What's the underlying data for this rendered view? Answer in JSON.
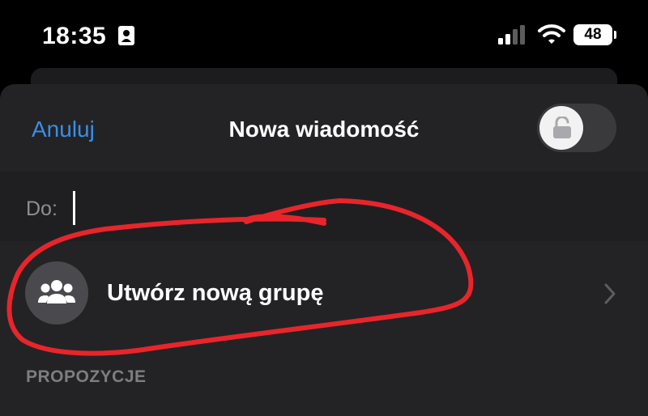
{
  "status_bar": {
    "time": "18:35",
    "battery": "48"
  },
  "header": {
    "cancel_label": "Anuluj",
    "title": "Nowa wiadomość"
  },
  "to_field": {
    "label": "Do:",
    "value": ""
  },
  "create_group": {
    "label": "Utwórz nową grupę"
  },
  "suggestions": {
    "header": "PROPOZYCJE"
  },
  "colors": {
    "accent": "#3a8ee6",
    "annotation": "#e8252b",
    "sheet_background": "#232325"
  },
  "icons": [
    "id-card-icon",
    "signal-icon",
    "wifi-icon",
    "battery-icon",
    "lock-icon",
    "people-icon",
    "chevron-right-icon"
  ]
}
